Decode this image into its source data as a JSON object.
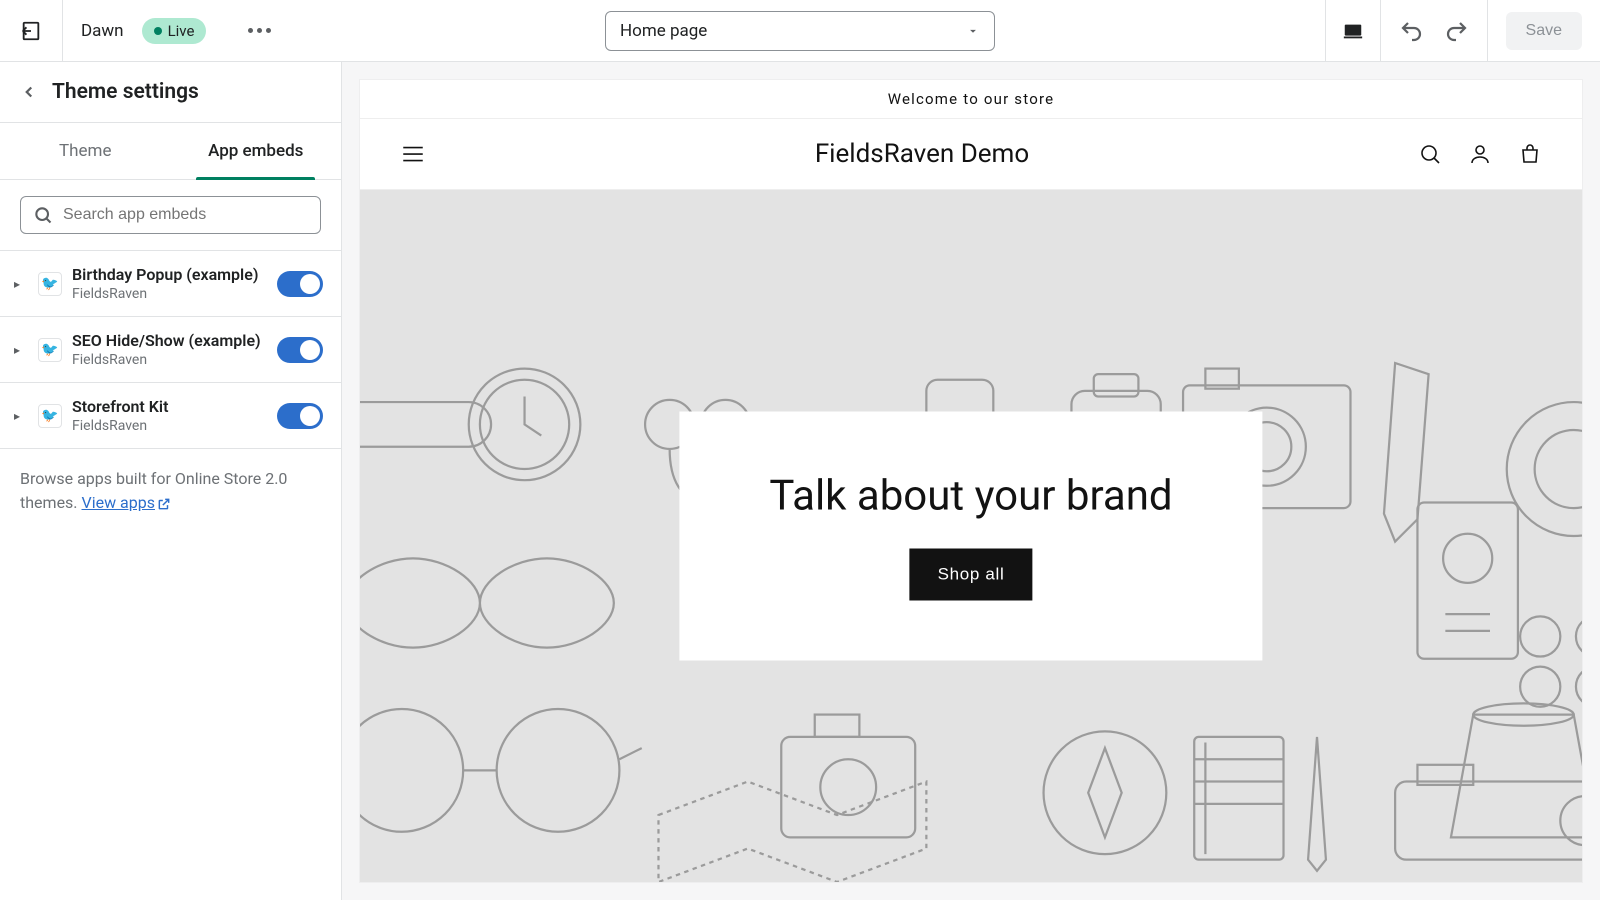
{
  "topbar": {
    "theme_name": "Dawn",
    "status_label": "Live",
    "page_selector": "Home page",
    "save_label": "Save"
  },
  "sidebar": {
    "title": "Theme settings",
    "tabs": {
      "theme": "Theme",
      "app_embeds": "App embeds"
    },
    "search_placeholder": "Search app embeds",
    "embeds": [
      {
        "title": "Birthday Popup (example)",
        "provider": "FieldsRaven",
        "enabled": true
      },
      {
        "title": "SEO Hide/Show (example)",
        "provider": "FieldsRaven",
        "enabled": true
      },
      {
        "title": "Storefront Kit",
        "provider": "FieldsRaven",
        "enabled": true
      }
    ],
    "browse_prefix": "Browse apps built for Online Store 2.0 themes. ",
    "browse_link": "View apps"
  },
  "preview": {
    "announcement": "Welcome to our store",
    "store_name": "FieldsRaven Demo",
    "hero_title": "Talk about your brand",
    "hero_button": "Shop all"
  }
}
